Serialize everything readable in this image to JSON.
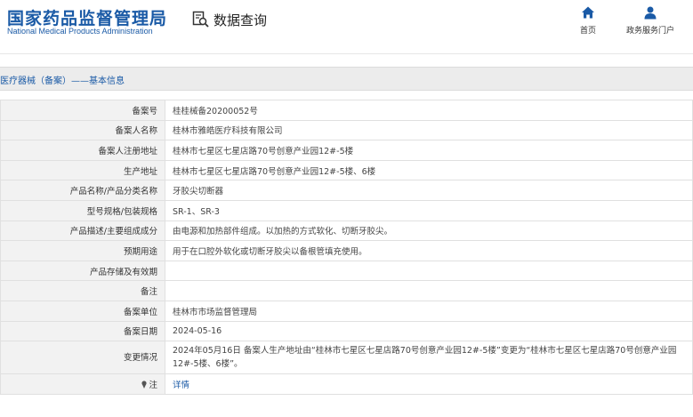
{
  "header": {
    "logo_cn": "国家药品监督管理局",
    "logo_en": "National Medical Products Administration",
    "query_label": "数据查询",
    "nav": {
      "home": "首页",
      "service": "政务服务门户"
    },
    "accent": "#1a5aa6"
  },
  "breadcrumb": "医疗器械（备案）——基本信息",
  "rows": [
    {
      "label": "备案号",
      "value": "桂桂械备20200052号"
    },
    {
      "label": "备案人名称",
      "value": "桂林市雅皓医疗科技有限公司"
    },
    {
      "label": "备案人注册地址",
      "value": "桂林市七星区七星店路70号创意产业园12#-5楼"
    },
    {
      "label": "生产地址",
      "value": "桂林市七星区七星店路70号创意产业园12#-5楼、6楼"
    },
    {
      "label": "产品名称/产品分类名称",
      "value": "牙胶尖切断器"
    },
    {
      "label": "型号规格/包装规格",
      "value": "SR-1、SR-3"
    },
    {
      "label": "产品描述/主要组成成分",
      "value": "由电源和加热部件组成。以加热的方式软化、切断牙胶尖。"
    },
    {
      "label": "预期用途",
      "value": "用于在口腔外软化或切断牙胶尖以备根管填充使用。"
    },
    {
      "label": "产品存储及有效期",
      "value": ""
    },
    {
      "label": "备注",
      "value": ""
    },
    {
      "label": "备案单位",
      "value": "桂林市市场监督管理局"
    },
    {
      "label": "备案日期",
      "value": "2024-05-16"
    },
    {
      "label": "变更情况",
      "value": "2024年05月16日 备案人生产地址由“桂林市七星区七星店路70号创意产业园12#-5楼”变更为“桂林市七星区七星店路70号创意产业园12#-5楼、6楼”。"
    }
  ],
  "note_row": {
    "label": "注",
    "value": "详情",
    "icon": "pin-icon"
  }
}
